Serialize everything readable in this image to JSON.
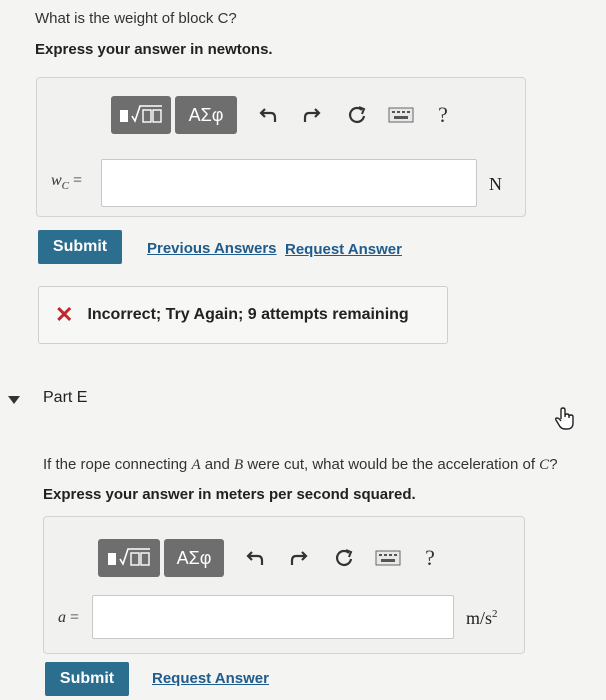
{
  "partD": {
    "question": "What is the weight of block C?",
    "instruction": "Express your answer in newtons.",
    "variable": "w",
    "variable_sub": "C",
    "equals": "=",
    "unit": "N",
    "submit_label": "Submit",
    "previous_answers_label": "Previous Answers",
    "request_answer_label": "Request Answer",
    "feedback": "Incorrect; Try Again; 9 attempts remaining"
  },
  "toolbar": {
    "greek_label": "ΑΣφ",
    "help_label": "?"
  },
  "partE": {
    "header": "Part E",
    "question_prefix": "If the rope connecting ",
    "question_A": "A",
    "question_mid": " and ",
    "question_B": "B",
    "question_suffix": " were cut, what would be the acceleration of ",
    "question_C": "C",
    "question_end": "?",
    "instruction": "Express your answer in meters per second squared.",
    "variable": "a",
    "equals": "=",
    "unit": "m/s",
    "unit_exp": "2",
    "submit_label": "Submit",
    "request_answer_label": "Request Answer"
  },
  "colors": {
    "submit": "#2c6e8e",
    "link": "#1f5b8c",
    "error": "#c0262d"
  },
  "icons": [
    "templates-icon",
    "greek-symbols-icon",
    "undo-icon",
    "redo-icon",
    "reset-icon",
    "keyboard-icon",
    "help-icon",
    "cursor-hand-icon",
    "collapse-triangle-icon",
    "incorrect-x-icon"
  ]
}
